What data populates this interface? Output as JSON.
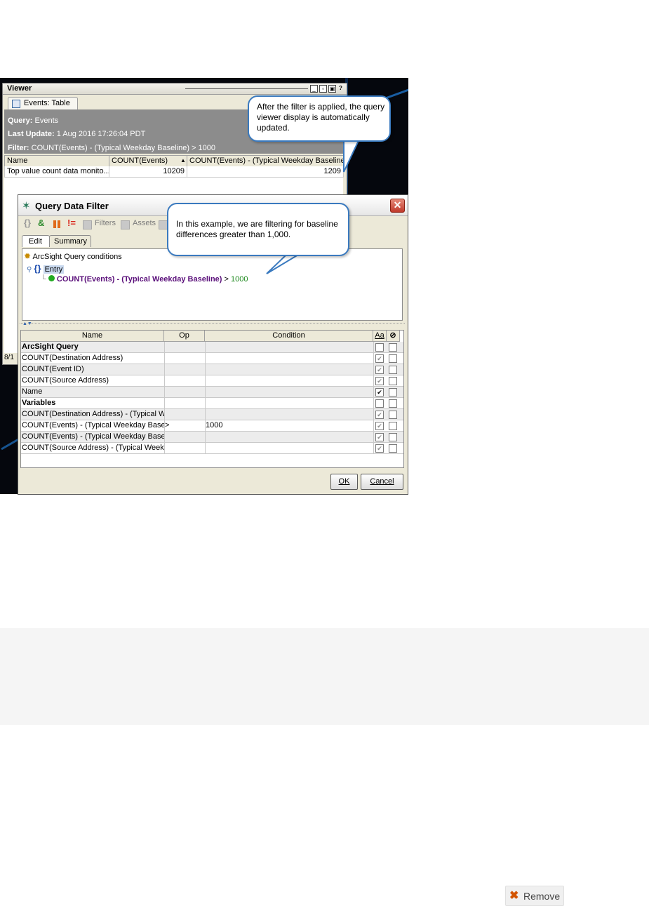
{
  "viewer": {
    "title": "Viewer",
    "tab_label": "Events: Table",
    "query_label": "Query:",
    "query_value": "Events",
    "last_update_label": "Last Update:",
    "last_update_value": "1 Aug 2016 17:26:04 PDT",
    "filter_label": "Filter:",
    "filter_value": "COUNT(Events) - (Typical Weekday Baseline) > 1000",
    "columns": [
      "Name",
      "COUNT(Events)",
      "COUNT(Events) - (Typical Weekday Baseline)"
    ],
    "sort_indicator": "▲",
    "rows": [
      [
        "Top value count data monito...",
        "10209",
        "1209"
      ]
    ],
    "status_text": "8/1"
  },
  "callouts": {
    "viewer_note": "After the filter is applied, the query viewer display is automatically updated.",
    "filter_note": "In this example, we are filtering for baseline differences greater than 1,000."
  },
  "dialog": {
    "title": "Query Data Filter",
    "toolbar": {
      "filters_label": "Filters",
      "assets_label": "Assets"
    },
    "tabs": [
      "Edit",
      "Summary"
    ],
    "tree": {
      "root": "ArcSight Query conditions",
      "entry": "Entry",
      "condition_field": "COUNT(Events) - (Typical Weekday Baseline)",
      "condition_op": ">",
      "condition_value": "1000"
    },
    "table": {
      "headers": [
        "Name",
        "Op",
        "Condition",
        "Aa",
        "⊘"
      ],
      "rows": [
        {
          "name": "ArcSight Query",
          "op": "",
          "condition": "",
          "bold": true,
          "c1": "",
          "c2": ""
        },
        {
          "name": "COUNT(Destination Address)",
          "op": "",
          "condition": "",
          "bold": false,
          "c1": "✔",
          "c2": ""
        },
        {
          "name": "COUNT(Event ID)",
          "op": "",
          "condition": "",
          "bold": false,
          "c1": "✔",
          "c2": ""
        },
        {
          "name": "COUNT(Source Address)",
          "op": "",
          "condition": "",
          "bold": false,
          "c1": "✔",
          "c2": ""
        },
        {
          "name": "Name",
          "op": "",
          "condition": "",
          "bold": false,
          "c1": "✔",
          "c2": ""
        },
        {
          "name": "Variables",
          "op": "",
          "condition": "",
          "bold": true,
          "c1": "",
          "c2": ""
        },
        {
          "name": "COUNT(Destination Address) - (Typical W...",
          "op": "",
          "condition": "",
          "bold": false,
          "c1": "✔",
          "c2": ""
        },
        {
          "name": "COUNT(Events) - (Typical Weekday Basel...",
          "op": ">",
          "condition": "1000",
          "bold": false,
          "c1": "✔",
          "c2": ""
        },
        {
          "name": "COUNT(Events) - (Typical Weekday Basel...",
          "op": "",
          "condition": "",
          "bold": false,
          "c1": "✔",
          "c2": ""
        },
        {
          "name": "COUNT(Source Address) - (Typical Week...",
          "op": "",
          "condition": "",
          "bold": false,
          "c1": "✔",
          "c2": ""
        }
      ]
    },
    "ok_label": "OK",
    "cancel_label": "Cancel"
  },
  "footer": {
    "remove_label": "Remove"
  },
  "colors": {
    "callout_border": "#3a7abf",
    "info_band": "#8c8c8c",
    "condition_field": "#5a0f7a",
    "condition_value": "#1f8a1f"
  }
}
